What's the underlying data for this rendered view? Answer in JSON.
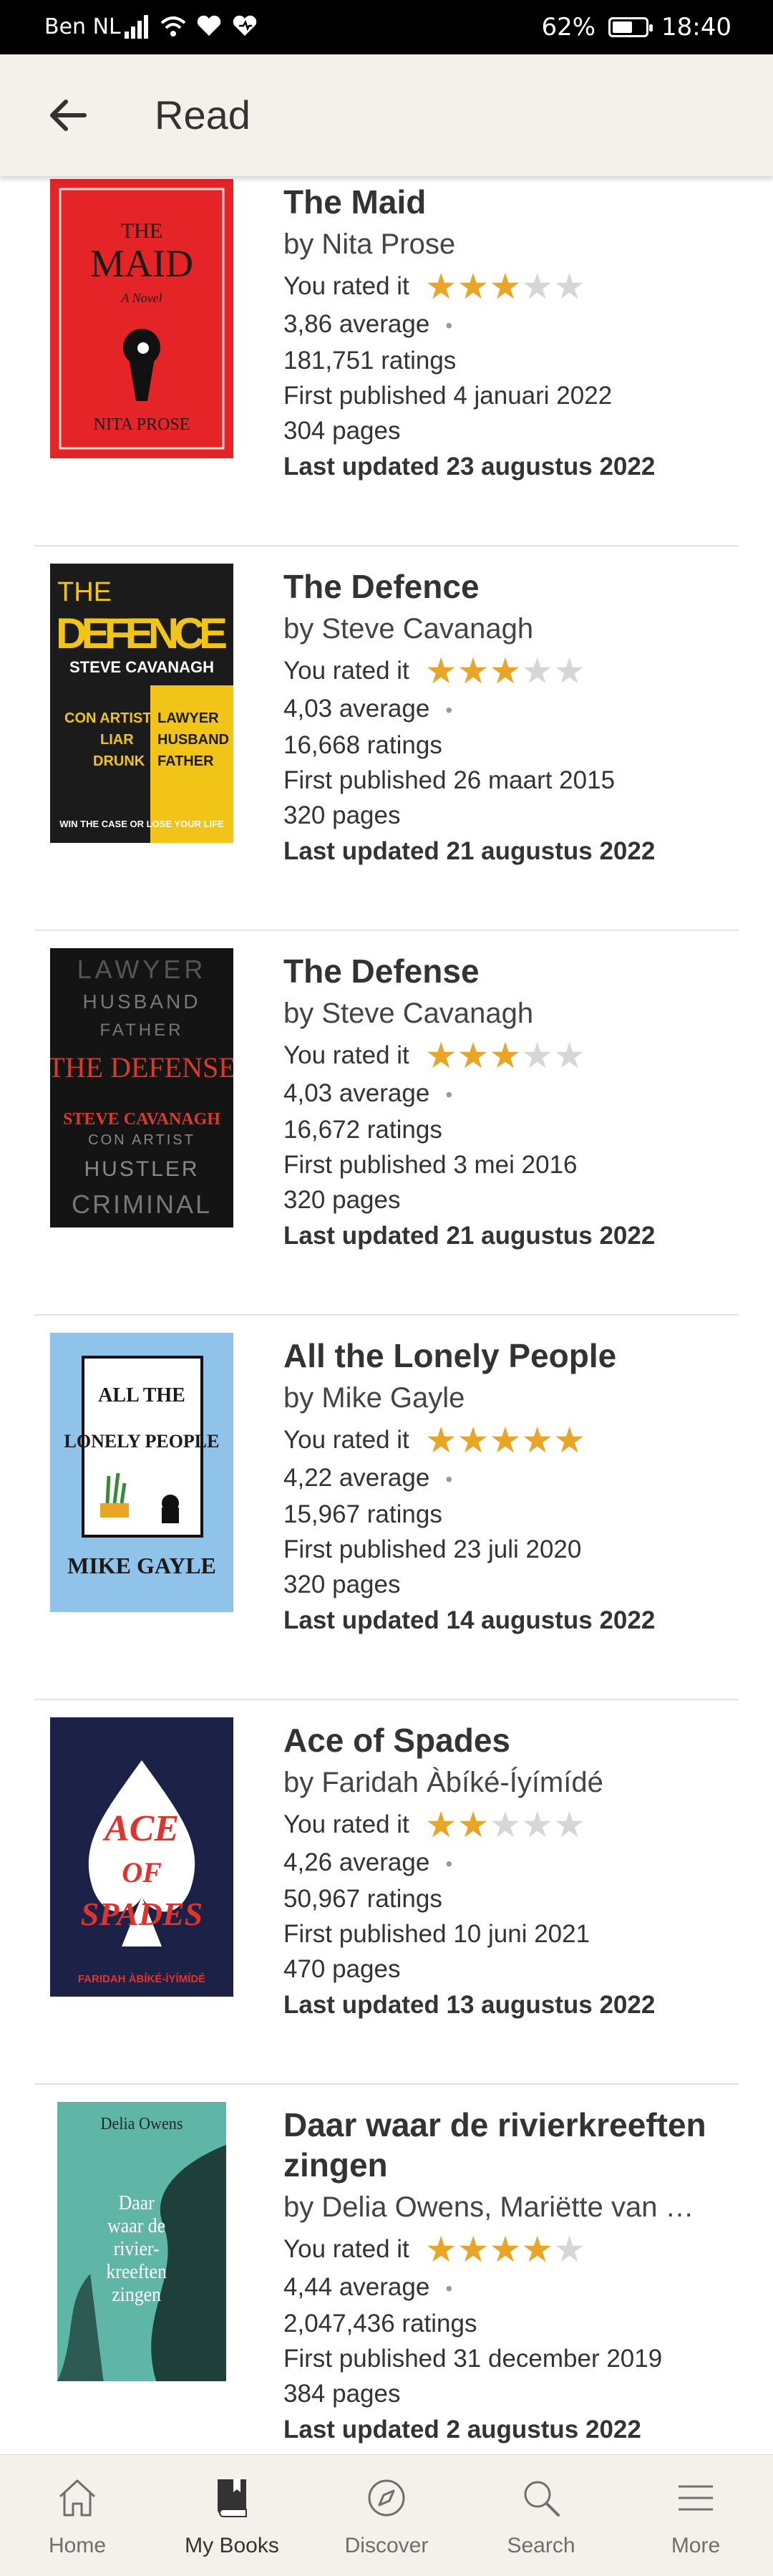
{
  "status": {
    "carrier": "Ben NL",
    "battery": "62%",
    "time": "18:40",
    "battery_level": 0.62
  },
  "appbar": {
    "title": "Read"
  },
  "labels": {
    "you_rated": "You rated it"
  },
  "books": [
    {
      "title": "The Maid",
      "author": "by Nita Prose",
      "rating": 3,
      "average": "3,86 average",
      "ratings": "181,751 ratings",
      "published": "First published 4 januari 2022",
      "pages": "304 pages",
      "updated": "Last updated 23 augustus 2022",
      "cover": {
        "bg": "#e52427",
        "fg": "#1a1a1a",
        "l1": "THE",
        "l2": "MAID",
        "l3": "A Novel",
        "l4": "NITA PROSE"
      }
    },
    {
      "title": "The Defence",
      "author": "by Steve Cavanagh",
      "rating": 3,
      "average": "4,03 average",
      "ratings": "16,668 ratings",
      "published": "First published 26 maart 2015",
      "pages": "320 pages",
      "updated": "Last updated 21 augustus 2022",
      "cover": {
        "bg": "#1b1b1b",
        "fg": "#f2c418",
        "l1": "THE",
        "l2": "DEFENCE",
        "l3": "STEVE CAVANAGH",
        "l4": "WIN THE CASE OR LOSE YOUR LIFE"
      }
    },
    {
      "title": "The Defense",
      "author": "by Steve Cavanagh",
      "rating": 3,
      "average": "4,03 average",
      "ratings": "16,672 ratings",
      "published": "First published 3 mei 2016",
      "pages": "320 pages",
      "updated": "Last updated 21 augustus 2022",
      "cover": {
        "bg": "#141414",
        "fg": "#d93a2b",
        "l1": "LAWYER",
        "l2": "THE DEFENSE",
        "l3": "STEVE CAVANAGH",
        "l4": "CRIMINAL"
      }
    },
    {
      "title": "All the Lonely People",
      "author": "by Mike Gayle",
      "rating": 5,
      "average": "4,22 average",
      "ratings": "15,967 ratings",
      "published": "First published 23 juli 2020",
      "pages": "320 pages",
      "updated": "Last updated 14 augustus 2022",
      "cover": {
        "bg": "#8fc3ea",
        "fg": "#1a1a1a",
        "l1": "ALL THE",
        "l2": "LONELY PEOPLE",
        "l3": "",
        "l4": "MIKE GAYLE"
      }
    },
    {
      "title": "Ace of Spades",
      "author": "by Faridah Àbíké-Íyímídé",
      "rating": 2,
      "average": "4,26 average",
      "ratings": "50,967 ratings",
      "published": "First published 10 juni 2021",
      "pages": "470 pages",
      "updated": "Last updated 13 augustus 2022",
      "cover": {
        "bg": "#1c2247",
        "fg": "#e0332e",
        "l1": "ACE",
        "l2": "OF SPADES",
        "l3": "",
        "l4": "FARIDAH ÀBÍKÉ-ÍYÍMÍDÉ"
      }
    },
    {
      "title": "Daar waar de rivierkreeften zingen",
      "author": "by Delia Owens, Mariëtte van …",
      "rating": 4,
      "average": "4,44 average",
      "ratings": "2,047,436 ratings",
      "published": "First published 31 december 2019",
      "pages": "384 pages",
      "updated": "Last updated 2 augustus 2022",
      "cover": {
        "bg": "#5fb5a6",
        "fg": "#ffffff",
        "l1": "Delia Owens",
        "l2": "Daar waar de rivier-kreeften zingen",
        "l3": "",
        "l4": ""
      }
    }
  ],
  "nav": [
    {
      "label": "Home",
      "icon": "home-icon"
    },
    {
      "label": "My Books",
      "icon": "book-icon"
    },
    {
      "label": "Discover",
      "icon": "compass-icon"
    },
    {
      "label": "Search",
      "icon": "search-icon"
    },
    {
      "label": "More",
      "icon": "menu-icon"
    }
  ],
  "colors": {
    "star_on": "#e8a526",
    "star_off": "#d6d6d6",
    "bar_bg": "#f4f1ea"
  }
}
